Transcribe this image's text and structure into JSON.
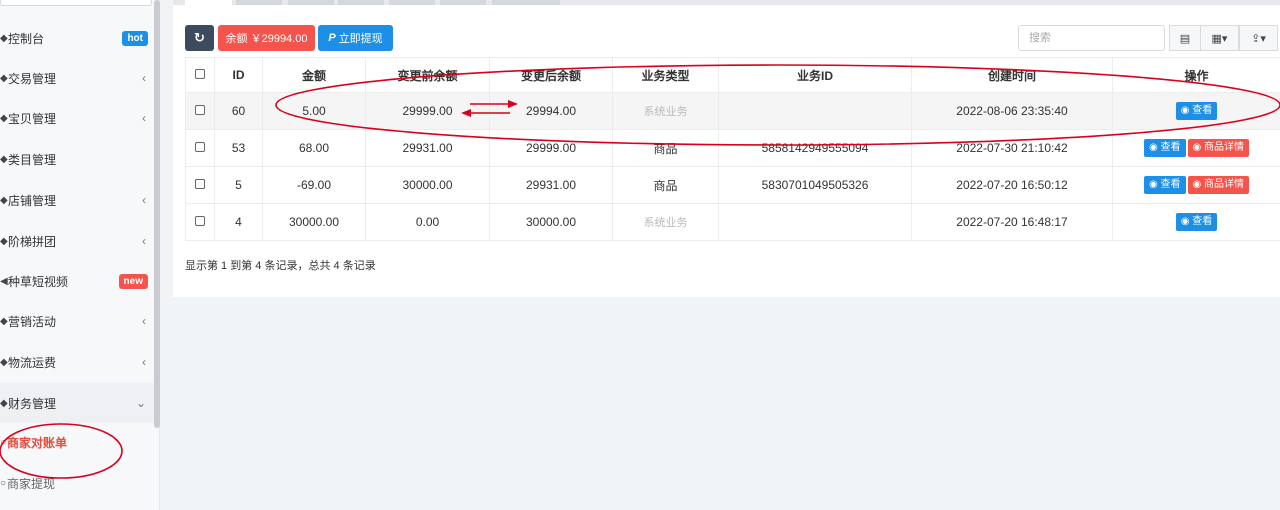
{
  "sidebar": {
    "items": [
      {
        "label": "控制台",
        "badge": "hot",
        "badge_color": "#1e8fe6",
        "arrow": ""
      },
      {
        "label": "交易管理",
        "badge": "",
        "arrow": "‹"
      },
      {
        "label": "宝贝管理",
        "badge": "",
        "arrow": "‹"
      },
      {
        "label": "类目管理",
        "badge": "",
        "arrow": ""
      },
      {
        "label": "店铺管理",
        "badge": "",
        "arrow": "‹"
      },
      {
        "label": "阶梯拼团",
        "badge": "",
        "arrow": "‹"
      },
      {
        "label": "种草短视频",
        "badge": "new",
        "badge_color": "#f4544b",
        "arrow": ""
      },
      {
        "label": "营销活动",
        "badge": "",
        "arrow": "‹"
      },
      {
        "label": "物流运费",
        "badge": "",
        "arrow": "‹"
      },
      {
        "label": "财务管理",
        "badge": "",
        "arrow": "⌄"
      }
    ],
    "sub_items": [
      {
        "label": "商家对账单",
        "selected": true
      },
      {
        "label": "商家提现",
        "selected": false
      }
    ]
  },
  "toolbar": {
    "refresh_icon": "refresh-icon",
    "balance_label": "余额 ￥29994.00",
    "withdraw_label": "立即提现",
    "search_placeholder": "搜索"
  },
  "table": {
    "headers": [
      "",
      "ID",
      "金额",
      "变更前余额",
      "变更后余额",
      "业务类型",
      "业务ID",
      "创建时间",
      "操作"
    ],
    "rows": [
      {
        "id": "60",
        "amount": "5.00",
        "before": "29999.00",
        "after": "29994.00",
        "type": "系统业务",
        "biz_id": "",
        "created": "2022-08-06 23:35:40",
        "detail": false
      },
      {
        "id": "53",
        "amount": "68.00",
        "before": "29931.00",
        "after": "29999.00",
        "type": "商品",
        "biz_id": "5858142949555094",
        "created": "2022-07-30 21:10:42",
        "detail": true
      },
      {
        "id": "5",
        "amount": "-69.00",
        "before": "30000.00",
        "after": "29931.00",
        "type": "商品",
        "biz_id": "5830701049505326",
        "created": "2022-07-20 16:50:12",
        "detail": true
      },
      {
        "id": "4",
        "amount": "30000.00",
        "before": "0.00",
        "after": "30000.00",
        "type": "系统业务",
        "biz_id": "",
        "created": "2022-07-20 16:48:17",
        "detail": false
      }
    ],
    "view_label": "查看",
    "detail_label": "商品详情"
  },
  "footer": {
    "summary": "显示第 1 到第 4 条记录，总共 4 条记录"
  },
  "colors": {
    "primary": "#1e8fe6",
    "danger": "#f4544b",
    "dark": "#3c4b5e",
    "annotation": "#d9001b"
  }
}
